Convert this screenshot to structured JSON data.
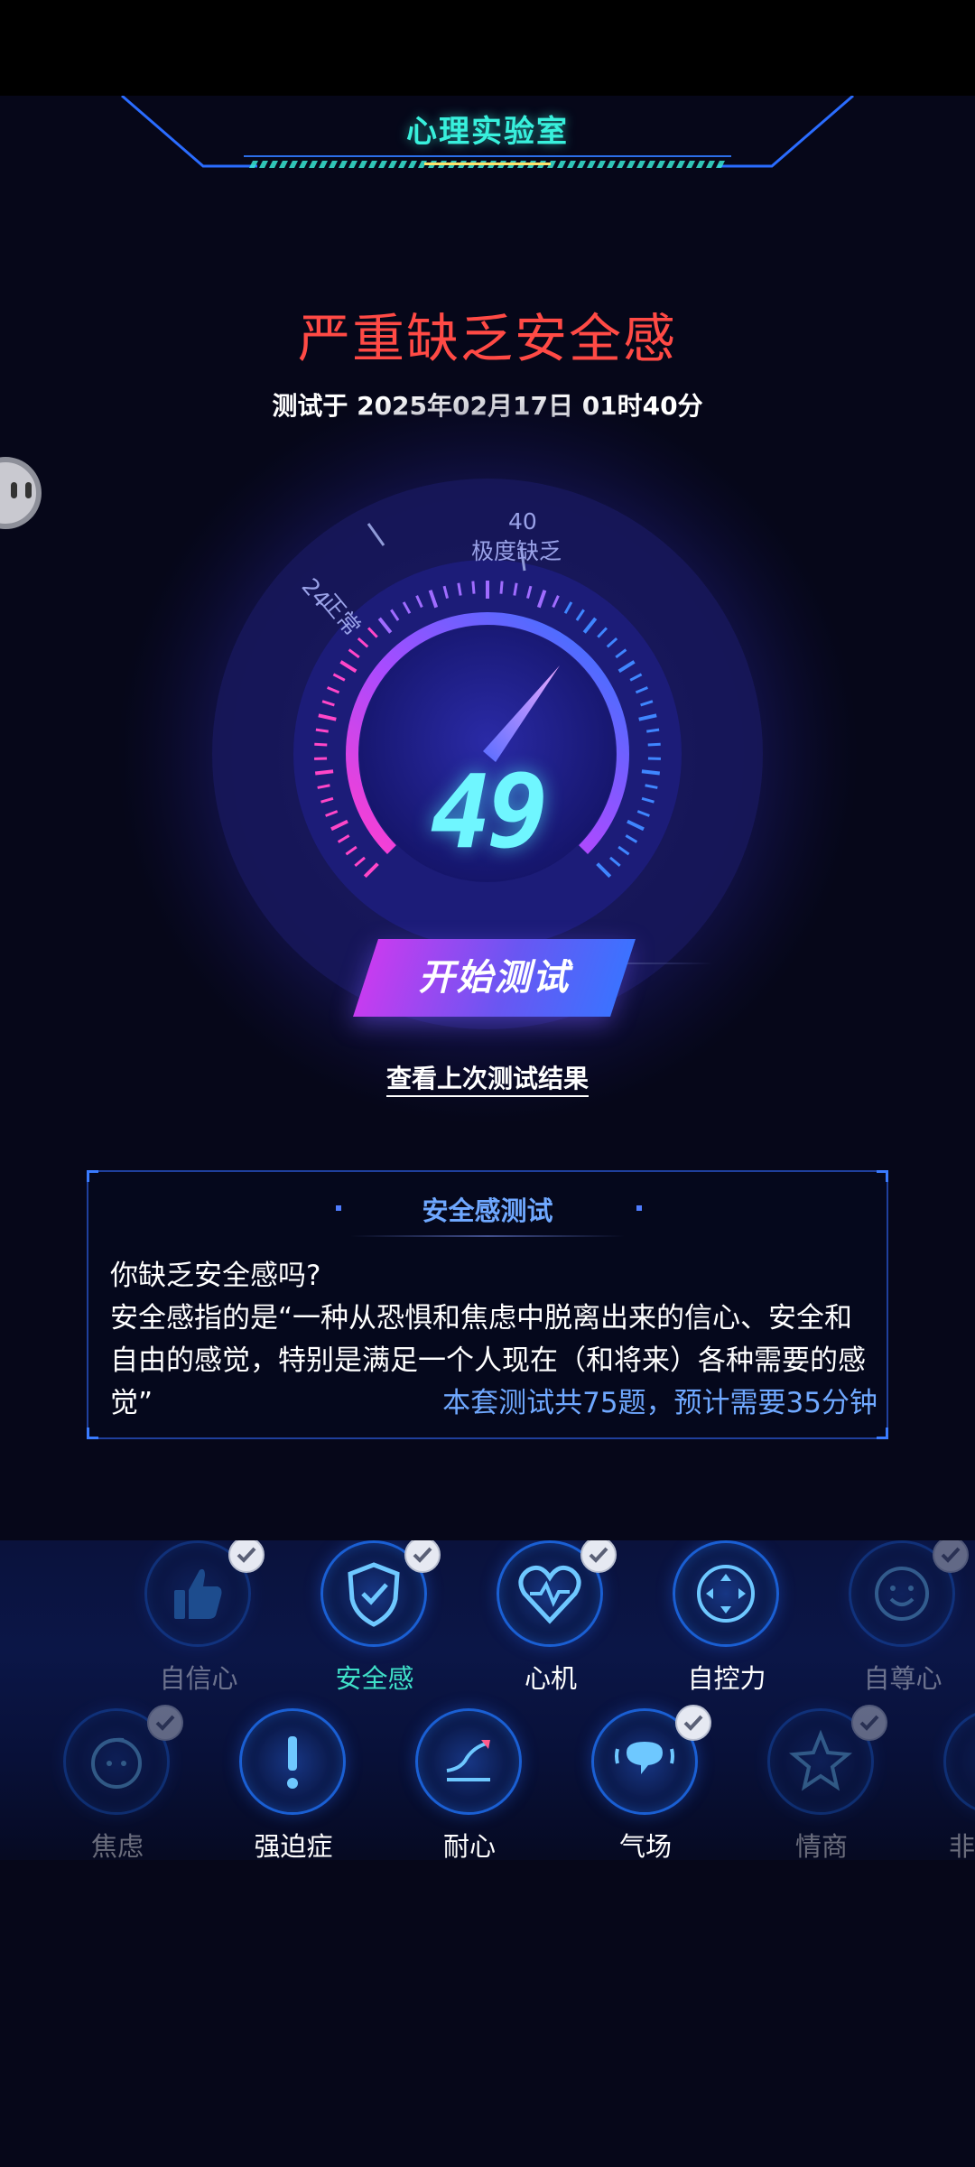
{
  "header": {
    "title": "心理实验室"
  },
  "result": {
    "title": "严重缺乏安全感",
    "tested_at": "测试于 2025年02月17日 01时40分"
  },
  "gauge": {
    "score": "49",
    "marker_normal_value": "24",
    "marker_normal_label": "正常",
    "marker_extreme_value": "40",
    "marker_extreme_label": "极度缺乏"
  },
  "actions": {
    "start_label": "开始测试",
    "last_result_label": "查看上次测试结果"
  },
  "info_panel": {
    "title": "安全感测试",
    "question": "你缺乏安全感吗?",
    "description": "安全感指的是“一种从恐惧和焦虑中脱离出来的信心、安全和自由的感觉，特别是满足一个人现在（和将来）各种需要的感觉”",
    "meta": "本套测试共75题，预计需要35分钟"
  },
  "categories_row1": [
    {
      "label": "自信心",
      "icon": "thumbs-up-icon",
      "checked": true
    },
    {
      "label": "安全感",
      "icon": "shield-check-icon",
      "checked": true,
      "selected": true
    },
    {
      "label": "心机",
      "icon": "heart-pulse-icon",
      "checked": true
    },
    {
      "label": "自控力",
      "icon": "move-arrows-icon",
      "checked": false
    },
    {
      "label": "自尊心",
      "icon": "smiley-face-icon",
      "checked": true
    }
  ],
  "categories_row2": [
    {
      "label": "焦虑",
      "icon": "anxious-face-icon",
      "checked": true
    },
    {
      "label": "强迫症",
      "icon": "exclamation-icon",
      "checked": false
    },
    {
      "label": "耐心",
      "icon": "trend-arrow-icon",
      "checked": false
    },
    {
      "label": "气场",
      "icon": "speech-bubble-icon",
      "checked": true
    },
    {
      "label": "情商",
      "icon": "star-icon",
      "checked": true
    },
    {
      "label": "非",
      "icon": "partial-icon",
      "checked": false
    }
  ],
  "colors": {
    "accent_title": "#38f0dc",
    "result_red": "#ff4a45",
    "score_cyan": "#6ff6ff",
    "link_blue": "#6fa8ff",
    "selected_label": "#3fe0c8"
  }
}
